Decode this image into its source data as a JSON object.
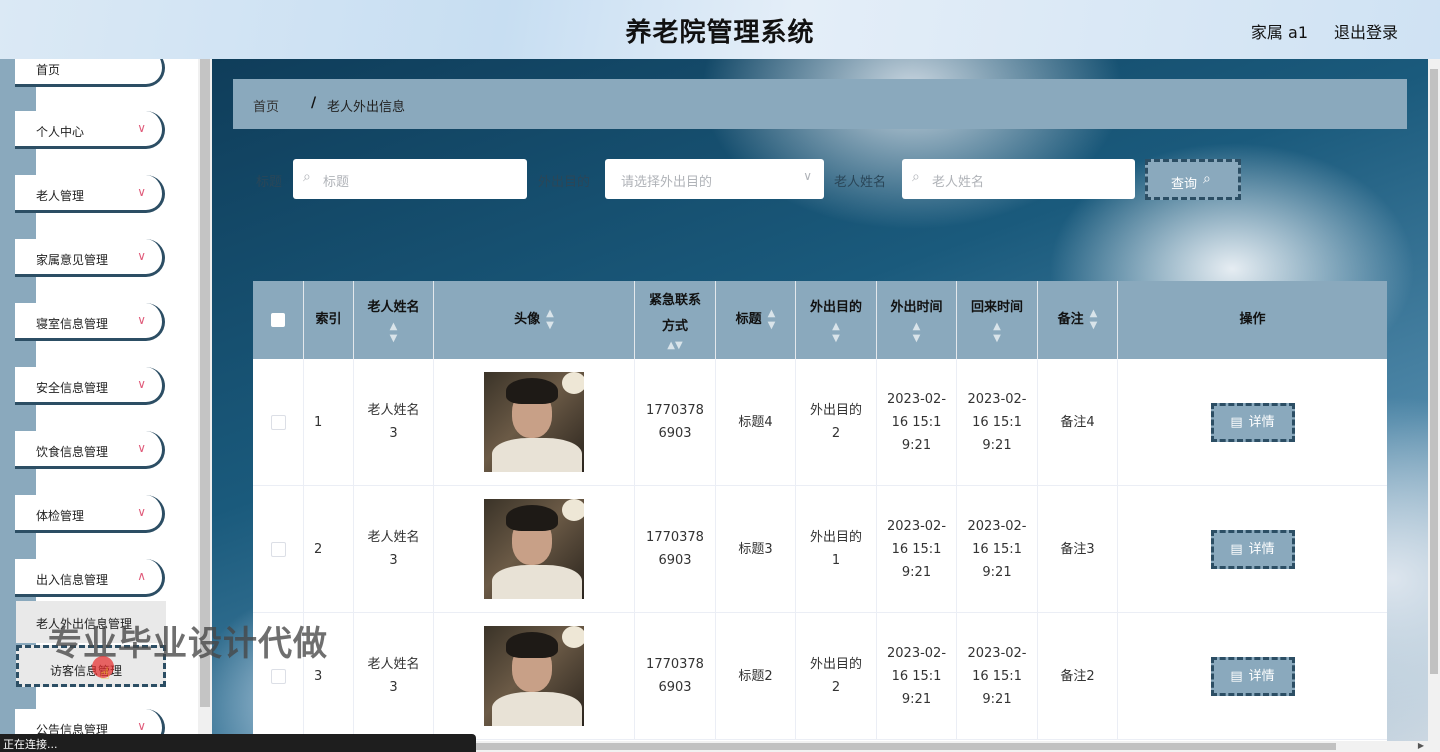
{
  "header": {
    "title": "养老院管理系统",
    "user": "家属 a1",
    "logout": "退出登录"
  },
  "sidebar": {
    "items": [
      {
        "label": "首页",
        "has_arrow": false
      },
      {
        "label": "个人中心",
        "has_arrow": true
      },
      {
        "label": "老人管理",
        "has_arrow": true
      },
      {
        "label": "家属意见管理",
        "has_arrow": true
      },
      {
        "label": "寝室信息管理",
        "has_arrow": true
      },
      {
        "label": "安全信息管理",
        "has_arrow": true
      },
      {
        "label": "饮食信息管理",
        "has_arrow": true
      },
      {
        "label": "体检管理",
        "has_arrow": true
      },
      {
        "label": "出入信息管理",
        "has_arrow": true
      }
    ],
    "sub_items": [
      {
        "label": "老人外出信息管理",
        "active": false
      },
      {
        "label": "访客信息管理",
        "active": true
      }
    ],
    "last_item": "公告信息管理"
  },
  "breadcrumb": {
    "home": "首页",
    "separator": "/",
    "current": "老人外出信息"
  },
  "filters": {
    "title_label": "标题",
    "title_placeholder": "标题",
    "purpose_label": "外出目的",
    "purpose_placeholder": "请选择外出目的",
    "name_label": "老人姓名",
    "name_placeholder": "老人姓名",
    "query_button": "查询"
  },
  "table": {
    "headers": [
      "索引",
      "老人姓名",
      "头像",
      "紧急联系方式",
      "标题",
      "外出目的",
      "外出时间",
      "回来时间",
      "备注",
      "操作"
    ],
    "rows": [
      {
        "index": "1",
        "name": "老人姓名3",
        "phone": "17703786903",
        "title": "标题4",
        "purpose": "外出目的2",
        "out_time": "2023-02-16 15:19:21",
        "back_time": "2023-02-16 15:19:21",
        "remark": "备注4",
        "action": "详情"
      },
      {
        "index": "2",
        "name": "老人姓名3",
        "phone": "17703786903",
        "title": "标题3",
        "purpose": "外出目的1",
        "out_time": "2023-02-16 15:19:21",
        "back_time": "2023-02-16 15:19:21",
        "remark": "备注3",
        "action": "详情"
      },
      {
        "index": "3",
        "name": "老人姓名3",
        "phone": "17703786903",
        "title": "标题2",
        "purpose": "外出目的2",
        "out_time": "2023-02-16 15:19:21",
        "back_time": "2023-02-16 15:19:21",
        "remark": "备注2",
        "action": "详情"
      }
    ]
  },
  "status_bar": "正在连接...",
  "watermark": "专业毕业设计代做",
  "colors": {
    "accent": "#8aa9bd",
    "dark": "#2c4e64",
    "chevron": "#e05b7a"
  }
}
